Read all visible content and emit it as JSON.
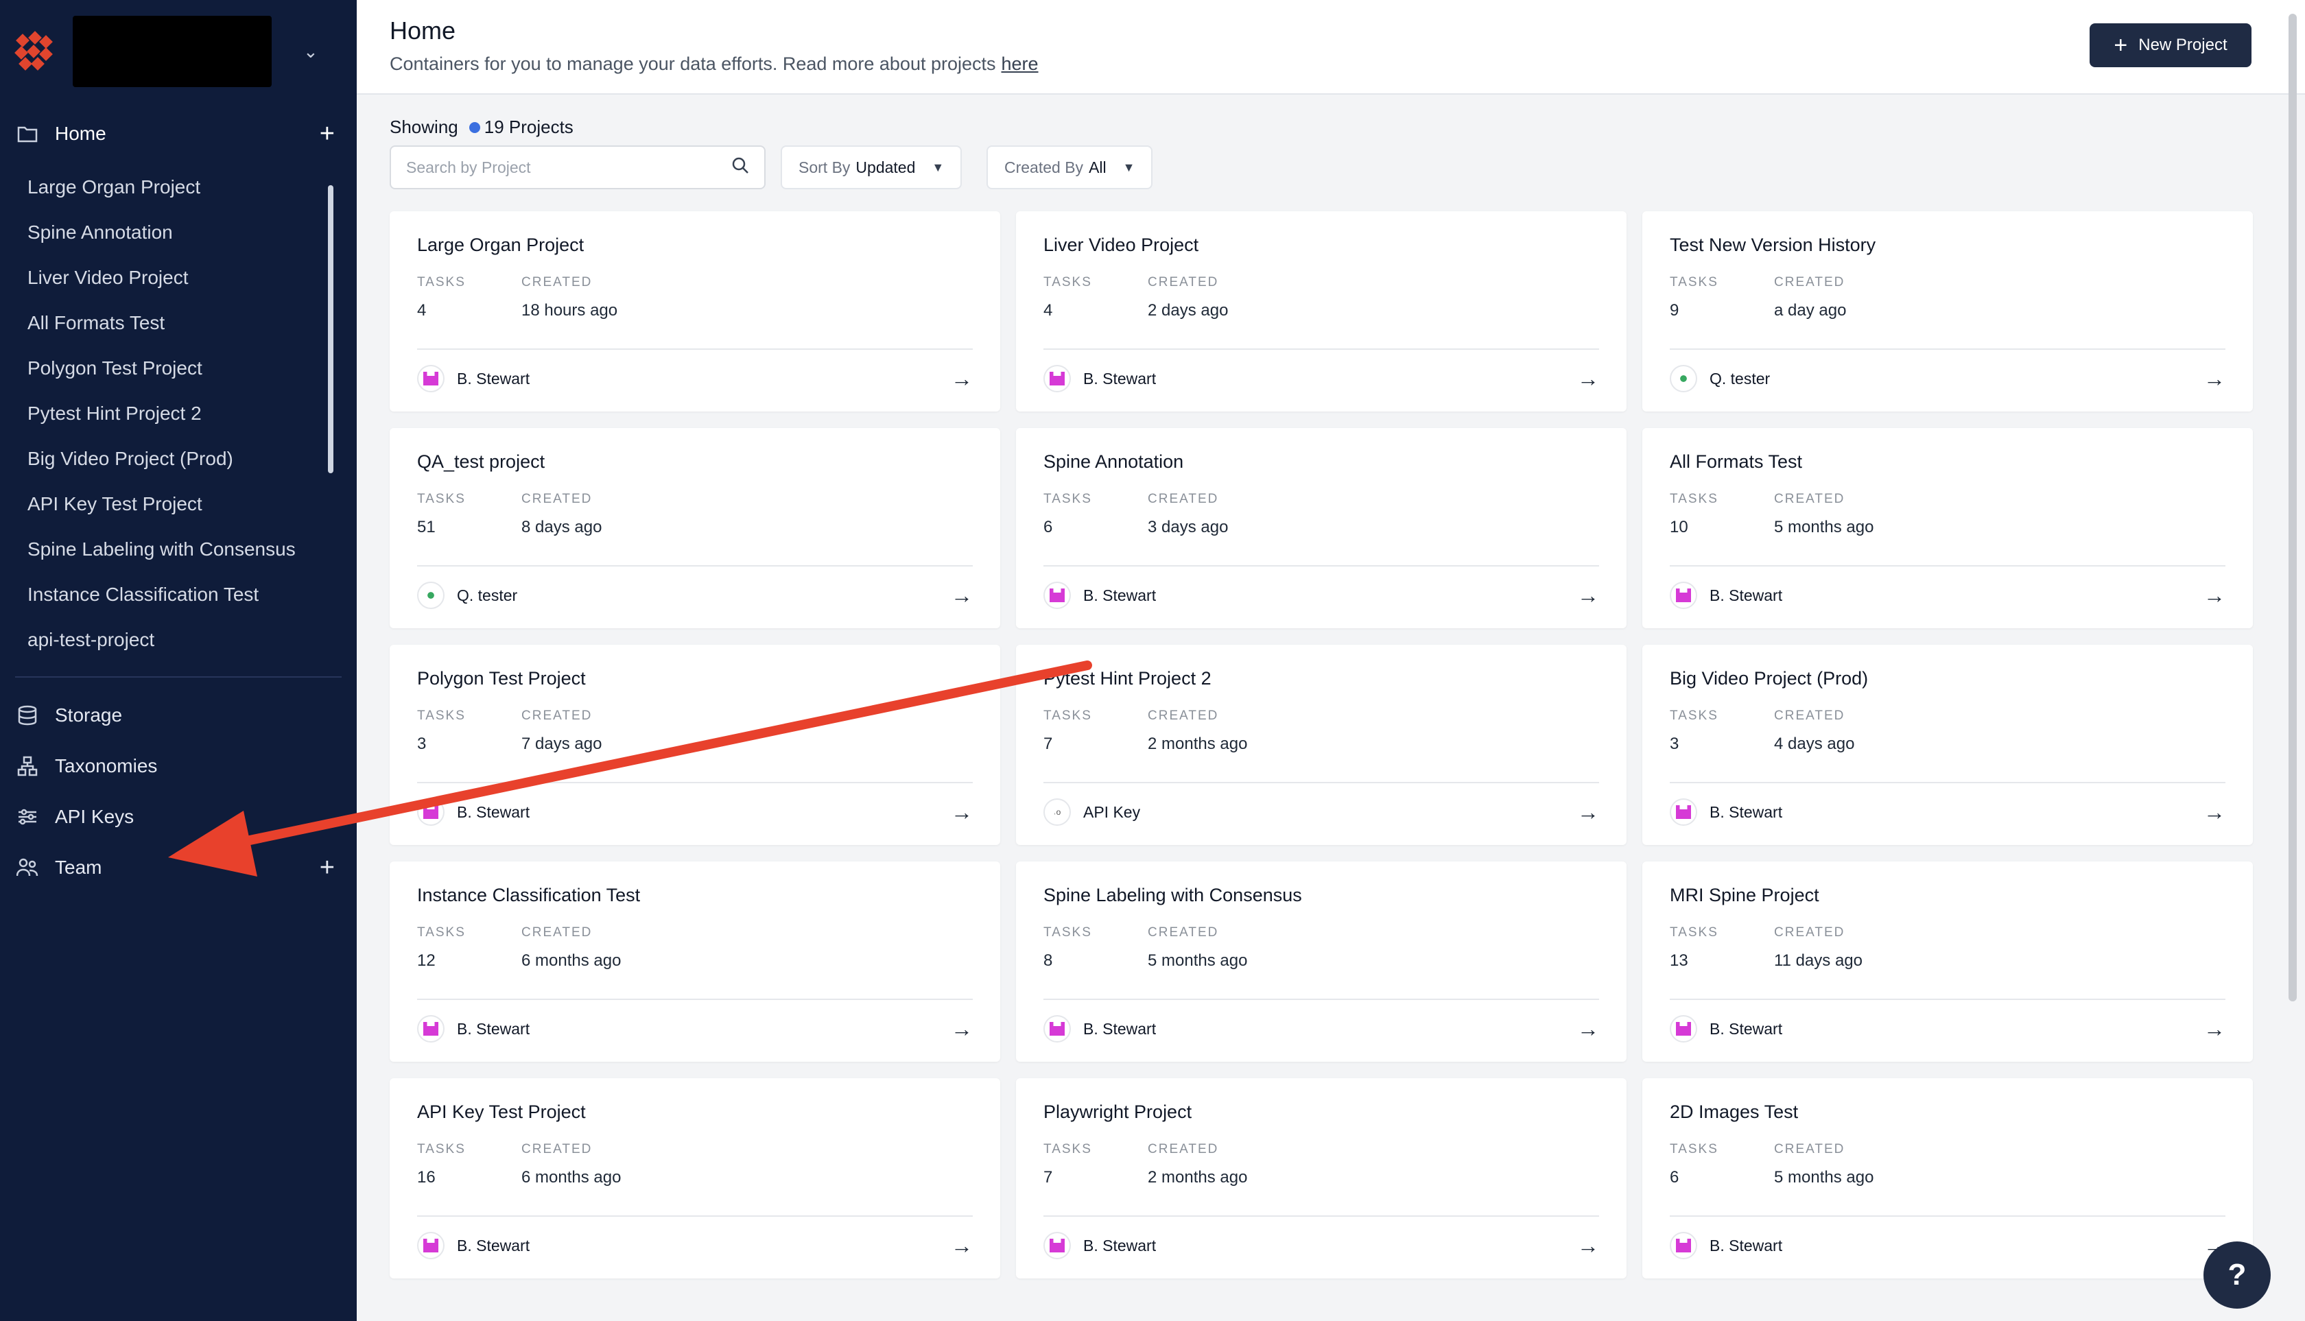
{
  "sidebar": {
    "home_label": "Home",
    "projects": [
      "Large Organ Project",
      "Spine Annotation",
      "Liver Video Project",
      "All Formats Test",
      "Polygon Test Project",
      "Pytest Hint Project 2",
      "Big Video Project (Prod)",
      "API Key Test Project",
      "Spine Labeling with Consensus",
      "Instance Classification Test",
      "api-test-project"
    ],
    "nav": {
      "storage": "Storage",
      "taxonomies": "Taxonomies",
      "api_keys": "API Keys",
      "team": "Team"
    }
  },
  "header": {
    "title": "Home",
    "subtitle": "Containers for you to manage your data efforts. Read more about projects",
    "link": "here",
    "new_project": "New Project"
  },
  "filters": {
    "showing_label": "Showing",
    "count_label": "19 Projects",
    "search_placeholder": "Search by Project",
    "sort_label": "Sort By",
    "sort_value": "Updated",
    "created_label": "Created By",
    "created_value": "All"
  },
  "labels": {
    "tasks": "TASKS",
    "created": "CREATED"
  },
  "cards": [
    {
      "title": "Large Organ Project",
      "tasks": "4",
      "created": "18 hours ago",
      "owner": "B. Stewart",
      "avatar": "pink"
    },
    {
      "title": "Liver Video Project",
      "tasks": "4",
      "created": "2 days ago",
      "owner": "B. Stewart",
      "avatar": "pink"
    },
    {
      "title": "Test New Version History",
      "tasks": "9",
      "created": "a day ago",
      "owner": "Q. tester",
      "avatar": "green"
    },
    {
      "title": "QA_test project",
      "tasks": "51",
      "created": "8 days ago",
      "owner": "Q. tester",
      "avatar": "green"
    },
    {
      "title": "Spine Annotation",
      "tasks": "6",
      "created": "3 days ago",
      "owner": "B. Stewart",
      "avatar": "pink"
    },
    {
      "title": "All Formats Test",
      "tasks": "10",
      "created": "5 months ago",
      "owner": "B. Stewart",
      "avatar": "pink"
    },
    {
      "title": "Polygon Test Project",
      "tasks": "3",
      "created": "7 days ago",
      "owner": "B. Stewart",
      "avatar": "pink"
    },
    {
      "title": "Pytest Hint Project 2",
      "tasks": "7",
      "created": "2 months ago",
      "owner": "API Key",
      "avatar": "api"
    },
    {
      "title": "Big Video Project (Prod)",
      "tasks": "3",
      "created": "4 days ago",
      "owner": "B. Stewart",
      "avatar": "pink"
    },
    {
      "title": "Instance Classification Test",
      "tasks": "12",
      "created": "6 months ago",
      "owner": "B. Stewart",
      "avatar": "pink"
    },
    {
      "title": "Spine Labeling with Consensus",
      "tasks": "8",
      "created": "5 months ago",
      "owner": "B. Stewart",
      "avatar": "pink"
    },
    {
      "title": "MRI Spine Project",
      "tasks": "13",
      "created": "11 days ago",
      "owner": "B. Stewart",
      "avatar": "pink"
    },
    {
      "title": "API Key Test Project",
      "tasks": "16",
      "created": "6 months ago",
      "owner": "B. Stewart",
      "avatar": "pink"
    },
    {
      "title": "Playwright Project",
      "tasks": "7",
      "created": "2 months ago",
      "owner": "B. Stewart",
      "avatar": "pink"
    },
    {
      "title": "2D Images Test",
      "tasks": "6",
      "created": "5 months ago",
      "owner": "B. Stewart",
      "avatar": "pink"
    }
  ],
  "help_label": "?",
  "colors": {
    "sidebar_bg": "#0f1c3a",
    "accent_dark": "#1f2b44",
    "annotation_arrow": "#e8412c"
  }
}
